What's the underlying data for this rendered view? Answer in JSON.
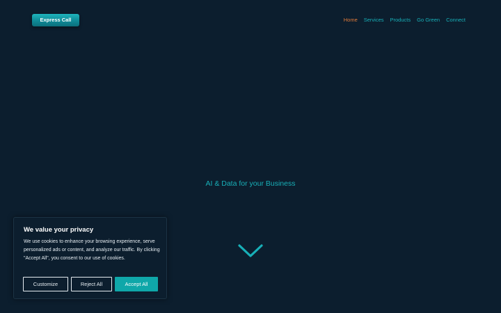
{
  "header": {
    "logo_label": "Express Call",
    "nav": [
      {
        "label": "Home",
        "active": true
      },
      {
        "label": "Services",
        "active": false
      },
      {
        "label": "Products",
        "active": false
      },
      {
        "label": "Go Green",
        "active": false
      },
      {
        "label": "Connect",
        "active": false
      }
    ]
  },
  "hero": {
    "tagline": "AI & Data for your Business",
    "scroll_icon": "chevron-down-icon"
  },
  "cookie_banner": {
    "title": "We value your privacy",
    "text": "We use cookies to enhance your browsing experience, serve personalized ads or content, and analyze our traffic. By clicking \"Accept All\", you consent to our use of cookies.",
    "customize_label": "Customize",
    "reject_label": "Reject All",
    "accept_label": "Accept All"
  },
  "colors": {
    "background": "#0c1e2e",
    "accent": "#18b0b8",
    "active_nav": "#e07a3a",
    "accept_button": "#0fa7a9"
  }
}
